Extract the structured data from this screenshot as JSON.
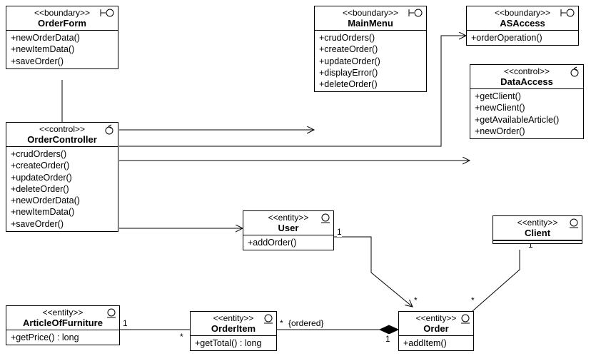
{
  "classes": {
    "orderForm": {
      "stereotype": "<<boundary>>",
      "name": "OrderForm",
      "ops": [
        "+newOrderData()",
        "+newItemData()",
        "+saveOrder()"
      ]
    },
    "mainMenu": {
      "stereotype": "<<boundary>>",
      "name": "MainMenu",
      "ops": [
        "+crudOrders()",
        "+createOrder()",
        "+updateOrder()",
        "+displayError()",
        "+deleteOrder()"
      ]
    },
    "asAccess": {
      "stereotype": "<<boundary>>",
      "name": "ASAccess",
      "ops": [
        "+orderOperation()"
      ]
    },
    "dataAccess": {
      "stereotype": "<<control>>",
      "name": "DataAccess",
      "ops": [
        "+getClient()",
        "+newClient()",
        "+getAvailableArticle()",
        "+newOrder()"
      ]
    },
    "orderController": {
      "stereotype": "<<control>>",
      "name": "OrderController",
      "ops": [
        "+crudOrders()",
        "+createOrder()",
        "+updateOrder()",
        "+deleteOrder()",
        "+newOrderData()",
        "+newItemData()",
        "+saveOrder()"
      ]
    },
    "user": {
      "stereotype": "<<entity>>",
      "name": "User",
      "ops": [
        "+addOrder()"
      ]
    },
    "client": {
      "stereotype": "<<entity>>",
      "name": "Client",
      "ops": []
    },
    "articleOfFurniture": {
      "stereotype": "<<entity>>",
      "name": "ArticleOfFurniture",
      "ops": [
        "+getPrice() : long"
      ]
    },
    "orderItem": {
      "stereotype": "<<entity>>",
      "name": "OrderItem",
      "ops": [
        "+getTotal() : long"
      ]
    },
    "order": {
      "stereotype": "<<entity>>",
      "name": "Order",
      "ops": [
        "+addItem()"
      ]
    }
  },
  "multiplicities": {
    "article_one": "1",
    "article_star": "*",
    "orderitem_star": "*",
    "ordered_constraint": "{ordered}",
    "order_one": "1",
    "user_one": "1",
    "user_star": "*",
    "client_one": "1",
    "client_star": "*"
  },
  "chart_data": {
    "type": "uml-class-diagram",
    "classes": [
      {
        "name": "OrderForm",
        "stereotype": "boundary",
        "operations": [
          "newOrderData()",
          "newItemData()",
          "saveOrder()"
        ]
      },
      {
        "name": "MainMenu",
        "stereotype": "boundary",
        "operations": [
          "crudOrders()",
          "createOrder()",
          "updateOrder()",
          "displayError()",
          "deleteOrder()"
        ]
      },
      {
        "name": "ASAccess",
        "stereotype": "boundary",
        "operations": [
          "orderOperation()"
        ]
      },
      {
        "name": "DataAccess",
        "stereotype": "control",
        "operations": [
          "getClient()",
          "newClient()",
          "getAvailableArticle()",
          "newOrder()"
        ]
      },
      {
        "name": "OrderController",
        "stereotype": "control",
        "operations": [
          "crudOrders()",
          "createOrder()",
          "updateOrder()",
          "deleteOrder()",
          "newOrderData()",
          "newItemData()",
          "saveOrder()"
        ]
      },
      {
        "name": "User",
        "stereotype": "entity",
        "operations": [
          "addOrder()"
        ]
      },
      {
        "name": "Client",
        "stereotype": "entity",
        "operations": []
      },
      {
        "name": "ArticleOfFurniture",
        "stereotype": "entity",
        "operations": [
          "getPrice() : long"
        ]
      },
      {
        "name": "OrderItem",
        "stereotype": "entity",
        "operations": [
          "getTotal() : long"
        ]
      },
      {
        "name": "Order",
        "stereotype": "entity",
        "operations": [
          "addItem()"
        ]
      }
    ],
    "associations": [
      {
        "from": "OrderForm",
        "to": "OrderController",
        "type": "association"
      },
      {
        "from": "OrderController",
        "to": "MainMenu",
        "type": "navigable"
      },
      {
        "from": "OrderController",
        "to": "ASAccess",
        "type": "navigable"
      },
      {
        "from": "OrderController",
        "to": "DataAccess",
        "type": "navigable"
      },
      {
        "from": "OrderController",
        "to": "User",
        "type": "navigable"
      },
      {
        "from": "User",
        "to": "Order",
        "type": "navigable",
        "from_mult": "1",
        "to_mult": "*"
      },
      {
        "from": "Client",
        "to": "Order",
        "type": "association",
        "from_mult": "1",
        "to_mult": "*"
      },
      {
        "from": "Order",
        "to": "OrderItem",
        "type": "composition",
        "from_mult": "1",
        "to_mult": "*",
        "constraint": "ordered"
      },
      {
        "from": "OrderItem",
        "to": "ArticleOfFurniture",
        "type": "association",
        "from_mult": "*",
        "to_mult": "1"
      }
    ]
  }
}
